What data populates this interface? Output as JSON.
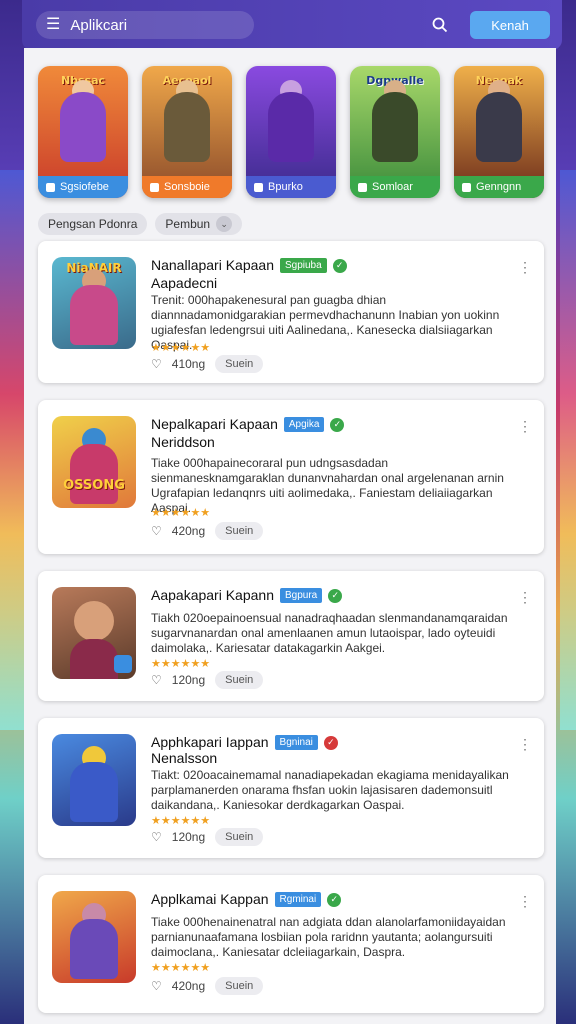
{
  "header": {
    "title": "Aplikcari",
    "action_label": "Kenah",
    "menu_icon": "menu-icon",
    "search_icon": "search-icon"
  },
  "featured": [
    {
      "label": "Sgsiofebe",
      "color": "#3a8ee0",
      "bg": "#e35a2c",
      "logo": "Nbssac"
    },
    {
      "label": "Sonsboie",
      "color": "#f07a2a",
      "bg": "#d9882c",
      "logo": "Aecoaol"
    },
    {
      "label": "Bpurko",
      "color": "#4a5bd0",
      "bg": "#7a3fd0",
      "logo": ""
    },
    {
      "label": "Somloar",
      "color": "#3aa84a",
      "bg": "#5ab84a",
      "logo": "Dgpwalle"
    },
    {
      "label": "Genngnn",
      "color": "#3aa84a",
      "bg": "#c8742c",
      "logo": "Neaoak"
    }
  ],
  "filters": [
    {
      "label": "Pengsan Pdonra"
    },
    {
      "label": "Pembun"
    }
  ],
  "apps": [
    {
      "title": "Nanallapari Kapaan",
      "subtitle": "Aapadecni",
      "badge": "Sgpiuba",
      "badge_color": "green",
      "verified": "green",
      "desc": "Trenit: 000hapakenesural pan guagba dhian diannnadamonidgarakian permevdhachanunn Inabian yon uokinn ugiafesfan ledengrsui uiti Aalinedana,. Kanesecka dialsiiagarkan Oaspai.",
      "stars": "★★★★★★",
      "count": "410ng",
      "pill": "Suein",
      "icon_bg": "#3c8fa8",
      "icon_text": "NiaNAIR"
    },
    {
      "title": "Nepalkapari Kapaan",
      "subtitle": "Neriddson",
      "badge": "Apgika",
      "badge_color": "blue",
      "verified": "green",
      "desc": "Tiake 000hapainecoraral pun udngsasdadan sienmanesknamgaraklan dunanvnahardan onal argelenanan arnin Ugrafapian ledanqnrs uiti aolimedaka,. Faniestam deliaiiagarkan Aaspai.",
      "stars": "★★★★★★",
      "count": "420ng",
      "pill": "Suein",
      "icon_bg": "#e8a63a",
      "icon_text": "OSSONG"
    },
    {
      "title": "Aapakapari Kapann",
      "subtitle": "",
      "badge": "Bgpura",
      "badge_color": "blue",
      "verified": "green",
      "desc": "Tiakh 020oepainoensual nanadraqhaadan slenmandanamqaraidan sugarvnanardan onal amenlaanen amun lutaoispar, lado oyteuidi daimolaka,. Kariesatar datakagarkin Aakgei.",
      "stars": "★★★★★★",
      "count": "120ng",
      "pill": "Suein",
      "icon_bg": "#8a5a3a",
      "icon_text": ""
    },
    {
      "title": "Apphkapari Iappan",
      "subtitle": "Nenalsson",
      "badge": "Bgninai",
      "badge_color": "blue",
      "verified": "red",
      "desc": "Tiakt: 020oacainemamal nanadiapekadan ekagiama menidayalikan parplamanerden onarama fhsfan uokin lajasisaren dademonsuitl daikandana,. Kaniesokar derdkagarkan Oaspai.",
      "stars": "★★★★★★",
      "count": "120ng",
      "pill": "Suein",
      "icon_bg": "#2a6ad0",
      "icon_text": ""
    },
    {
      "title": "Applkamai Kappan",
      "subtitle": "",
      "badge": "Rgminai",
      "badge_color": "blue",
      "verified": "green",
      "desc": "Tiake 000henainenatral nan adgiata ddan alanolarfamoniidayaidan parnianunaafamana losbiian pola raridnn yautanta; aolangursuiti daimoclana,. Kaniesatar dcleiiagarkain, Daspra.",
      "stars": "★★★★★★",
      "count": "420ng",
      "pill": "Suein",
      "icon_bg": "#e86a2a",
      "icon_text": ""
    }
  ],
  "colors": {
    "header": "#4a3ba8",
    "accent": "#5aa8f0",
    "star": "#f0a020"
  }
}
